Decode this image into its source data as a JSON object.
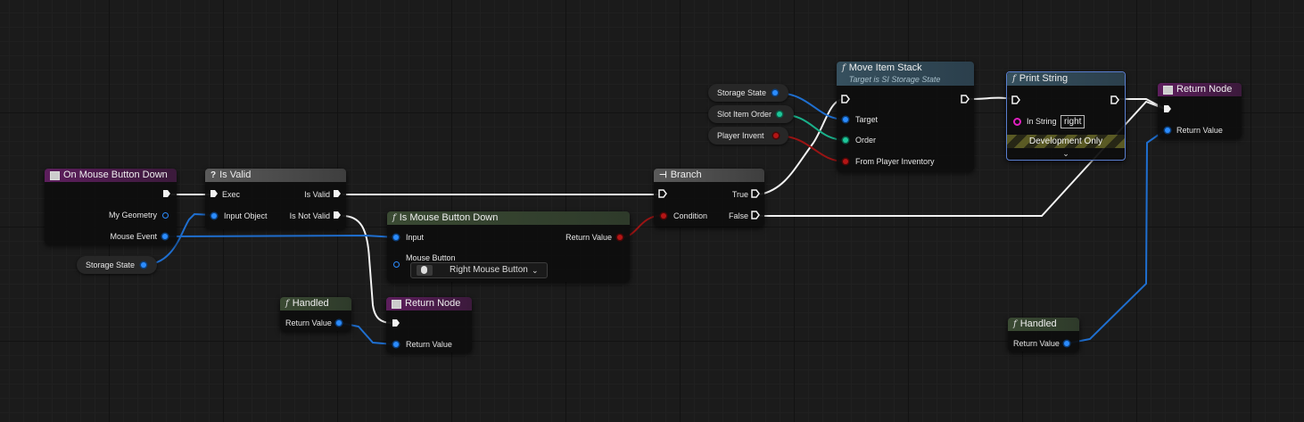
{
  "colors": {
    "exec_wire": "#f2f2f2",
    "struct_wire": "#1f6fd0",
    "bool_wire": "#9a1414",
    "int_wire": "#19b08a",
    "event_header": "#5d1e5d",
    "function_header": "#36505e",
    "pure_header": "#3a4a33"
  },
  "nodes": {
    "on_mouse_button_down": {
      "title": "On Mouse Button Down",
      "icon": "event-icon",
      "pins": {
        "my_geometry": "My Geometry",
        "mouse_event": "Mouse Event"
      }
    },
    "storage_state_var1": {
      "label": "Storage State"
    },
    "is_valid": {
      "title": "Is Valid",
      "icon": "question-icon",
      "pins": {
        "exec": "Exec",
        "input_object": "Input Object",
        "is_valid": "Is Valid",
        "is_not_valid": "Is Not Valid"
      }
    },
    "is_mouse_button_down": {
      "title": "Is Mouse Button Down",
      "pins": {
        "input": "Input",
        "mouse_button": "Mouse Button",
        "return_value": "Return Value"
      },
      "mouse_button_value": "Right Mouse Button"
    },
    "branch": {
      "title": "Branch",
      "icon": "branch-icon",
      "pins": {
        "condition": "Condition",
        "true": "True",
        "false": "False"
      }
    },
    "handled_left": {
      "title": "Handled",
      "pins": {
        "return_value": "Return Value"
      }
    },
    "return_node_left": {
      "title": "Return Node",
      "pins": {
        "return_value": "Return Value"
      }
    },
    "storage_state_var2": {
      "label": "Storage State"
    },
    "slot_item_order_var": {
      "label": "Slot Item Order"
    },
    "player_invent_var": {
      "label": "Player Invent"
    },
    "move_item_stack": {
      "title": "Move Item Stack",
      "subtitle": "Target is SI Storage State",
      "pins": {
        "target": "Target",
        "order": "Order",
        "from_player_inventory": "From Player Inventory"
      }
    },
    "print_string": {
      "title": "Print String",
      "pins": {
        "in_string": "In String"
      },
      "in_string_value": "right",
      "dev_only": "Development Only"
    },
    "return_node_right": {
      "title": "Return Node",
      "pins": {
        "return_value": "Return Value"
      }
    },
    "handled_right": {
      "title": "Handled",
      "pins": {
        "return_value": "Return Value"
      }
    }
  }
}
